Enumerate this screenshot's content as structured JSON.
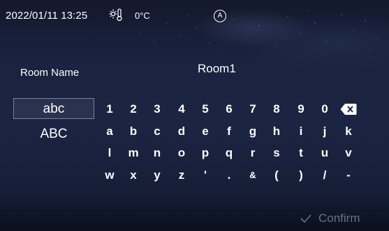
{
  "status_bar": {
    "datetime": "2022/01/11 13:25",
    "temperature": "0°C",
    "temperature_icon": "thermometer-sun-icon",
    "auto_mode_letter": "A",
    "auto_mode_icon": "auto-mode-icon"
  },
  "form": {
    "label": "Room Name",
    "value": "Room1"
  },
  "keyboard": {
    "mode_lower_label": "abc",
    "mode_upper_label": "ABC",
    "active_mode": "abc",
    "row1": [
      "1",
      "2",
      "3",
      "4",
      "5",
      "6",
      "7",
      "8",
      "9",
      "0"
    ],
    "row2": [
      "a",
      "b",
      "c",
      "d",
      "e",
      "f",
      "g",
      "h",
      "i",
      "j",
      "k"
    ],
    "row3": [
      "l",
      "m",
      "n",
      "o",
      "p",
      "q",
      "r",
      "s",
      "t",
      "u",
      "v"
    ],
    "row4": [
      "w",
      "x",
      "y",
      "z",
      "'",
      ".",
      "&",
      "(",
      ")",
      "/",
      "-"
    ],
    "backspace_icon": "backspace-icon"
  },
  "footer": {
    "confirm_label": "Confirm",
    "confirm_icon": "checkmark-icon"
  },
  "colors": {
    "background": "#1b2442",
    "text": "#ffffff",
    "disabled_text": "#6b7282"
  }
}
